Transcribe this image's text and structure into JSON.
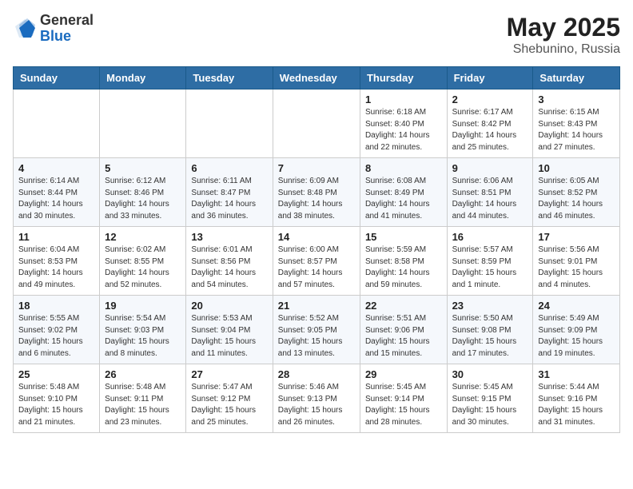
{
  "header": {
    "logo_line1": "General",
    "logo_line2": "Blue",
    "month_year": "May 2025",
    "location": "Shebunino, Russia"
  },
  "days_of_week": [
    "Sunday",
    "Monday",
    "Tuesday",
    "Wednesday",
    "Thursday",
    "Friday",
    "Saturday"
  ],
  "weeks": [
    [
      {
        "day": "",
        "content": ""
      },
      {
        "day": "",
        "content": ""
      },
      {
        "day": "",
        "content": ""
      },
      {
        "day": "",
        "content": ""
      },
      {
        "day": "1",
        "content": "Sunrise: 6:18 AM\nSunset: 8:40 PM\nDaylight: 14 hours\nand 22 minutes."
      },
      {
        "day": "2",
        "content": "Sunrise: 6:17 AM\nSunset: 8:42 PM\nDaylight: 14 hours\nand 25 minutes."
      },
      {
        "day": "3",
        "content": "Sunrise: 6:15 AM\nSunset: 8:43 PM\nDaylight: 14 hours\nand 27 minutes."
      }
    ],
    [
      {
        "day": "4",
        "content": "Sunrise: 6:14 AM\nSunset: 8:44 PM\nDaylight: 14 hours\nand 30 minutes."
      },
      {
        "day": "5",
        "content": "Sunrise: 6:12 AM\nSunset: 8:46 PM\nDaylight: 14 hours\nand 33 minutes."
      },
      {
        "day": "6",
        "content": "Sunrise: 6:11 AM\nSunset: 8:47 PM\nDaylight: 14 hours\nand 36 minutes."
      },
      {
        "day": "7",
        "content": "Sunrise: 6:09 AM\nSunset: 8:48 PM\nDaylight: 14 hours\nand 38 minutes."
      },
      {
        "day": "8",
        "content": "Sunrise: 6:08 AM\nSunset: 8:49 PM\nDaylight: 14 hours\nand 41 minutes."
      },
      {
        "day": "9",
        "content": "Sunrise: 6:06 AM\nSunset: 8:51 PM\nDaylight: 14 hours\nand 44 minutes."
      },
      {
        "day": "10",
        "content": "Sunrise: 6:05 AM\nSunset: 8:52 PM\nDaylight: 14 hours\nand 46 minutes."
      }
    ],
    [
      {
        "day": "11",
        "content": "Sunrise: 6:04 AM\nSunset: 8:53 PM\nDaylight: 14 hours\nand 49 minutes."
      },
      {
        "day": "12",
        "content": "Sunrise: 6:02 AM\nSunset: 8:55 PM\nDaylight: 14 hours\nand 52 minutes."
      },
      {
        "day": "13",
        "content": "Sunrise: 6:01 AM\nSunset: 8:56 PM\nDaylight: 14 hours\nand 54 minutes."
      },
      {
        "day": "14",
        "content": "Sunrise: 6:00 AM\nSunset: 8:57 PM\nDaylight: 14 hours\nand 57 minutes."
      },
      {
        "day": "15",
        "content": "Sunrise: 5:59 AM\nSunset: 8:58 PM\nDaylight: 14 hours\nand 59 minutes."
      },
      {
        "day": "16",
        "content": "Sunrise: 5:57 AM\nSunset: 8:59 PM\nDaylight: 15 hours\nand 1 minute."
      },
      {
        "day": "17",
        "content": "Sunrise: 5:56 AM\nSunset: 9:01 PM\nDaylight: 15 hours\nand 4 minutes."
      }
    ],
    [
      {
        "day": "18",
        "content": "Sunrise: 5:55 AM\nSunset: 9:02 PM\nDaylight: 15 hours\nand 6 minutes."
      },
      {
        "day": "19",
        "content": "Sunrise: 5:54 AM\nSunset: 9:03 PM\nDaylight: 15 hours\nand 8 minutes."
      },
      {
        "day": "20",
        "content": "Sunrise: 5:53 AM\nSunset: 9:04 PM\nDaylight: 15 hours\nand 11 minutes."
      },
      {
        "day": "21",
        "content": "Sunrise: 5:52 AM\nSunset: 9:05 PM\nDaylight: 15 hours\nand 13 minutes."
      },
      {
        "day": "22",
        "content": "Sunrise: 5:51 AM\nSunset: 9:06 PM\nDaylight: 15 hours\nand 15 minutes."
      },
      {
        "day": "23",
        "content": "Sunrise: 5:50 AM\nSunset: 9:08 PM\nDaylight: 15 hours\nand 17 minutes."
      },
      {
        "day": "24",
        "content": "Sunrise: 5:49 AM\nSunset: 9:09 PM\nDaylight: 15 hours\nand 19 minutes."
      }
    ],
    [
      {
        "day": "25",
        "content": "Sunrise: 5:48 AM\nSunset: 9:10 PM\nDaylight: 15 hours\nand 21 minutes."
      },
      {
        "day": "26",
        "content": "Sunrise: 5:48 AM\nSunset: 9:11 PM\nDaylight: 15 hours\nand 23 minutes."
      },
      {
        "day": "27",
        "content": "Sunrise: 5:47 AM\nSunset: 9:12 PM\nDaylight: 15 hours\nand 25 minutes."
      },
      {
        "day": "28",
        "content": "Sunrise: 5:46 AM\nSunset: 9:13 PM\nDaylight: 15 hours\nand 26 minutes."
      },
      {
        "day": "29",
        "content": "Sunrise: 5:45 AM\nSunset: 9:14 PM\nDaylight: 15 hours\nand 28 minutes."
      },
      {
        "day": "30",
        "content": "Sunrise: 5:45 AM\nSunset: 9:15 PM\nDaylight: 15 hours\nand 30 minutes."
      },
      {
        "day": "31",
        "content": "Sunrise: 5:44 AM\nSunset: 9:16 PM\nDaylight: 15 hours\nand 31 minutes."
      }
    ]
  ]
}
